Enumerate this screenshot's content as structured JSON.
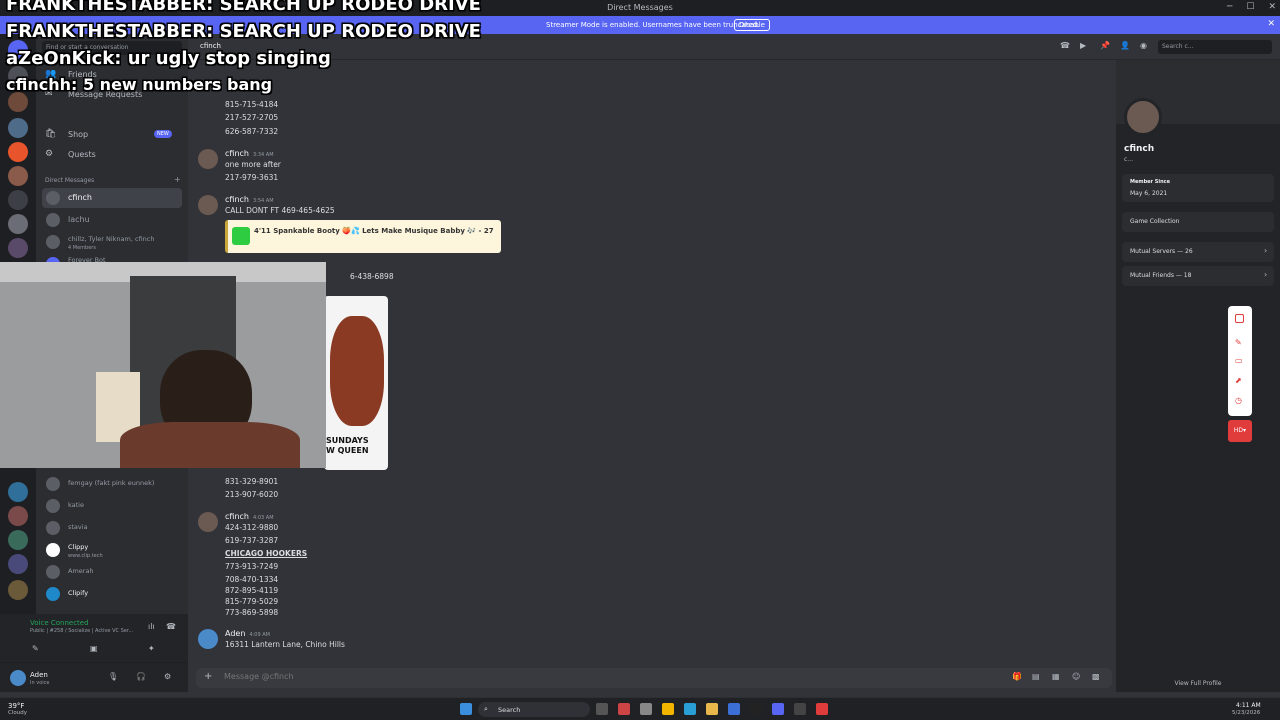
{
  "window": {
    "title": "Direct Messages"
  },
  "streamer_banner": {
    "text": "Streamer Mode is enabled. Usernames have been truncated.",
    "button": "Disable"
  },
  "overlay_chat": [
    {
      "name": "FRANKTHESTABBER",
      "text": ": SEARCH UP RODEO DRIVE"
    },
    {
      "name": "FRANKTHESTABBER",
      "text": ": SEARCH UP RODEO DRIVE"
    },
    {
      "name": "aZeOnKick",
      "text": ": ur ugly stop singing"
    },
    {
      "name": "cfinchh",
      "text": ": 5 new numbers bang"
    }
  ],
  "dm_sidebar": {
    "search_placeholder": "Find or start a conversation",
    "nav": [
      {
        "label": "Friends",
        "icon": "friends-icon"
      },
      {
        "label": "Message Requests",
        "icon": "mail-icon"
      },
      {
        "label": "Shop",
        "icon": "shop-icon",
        "badge": "NEW"
      },
      {
        "label": "Quests",
        "icon": "quests-icon"
      }
    ],
    "section_title": "Direct Messages",
    "dms_top": [
      {
        "name": "cfinch",
        "sub": ""
      },
      {
        "name": "lachu",
        "sub": ""
      },
      {
        "name": "chillz, Tyler Niknam, cfinch",
        "sub": "4 Members"
      },
      {
        "name": "Forever Bot",
        "sub": ""
      }
    ],
    "dms_bottom": [
      {
        "name": "femgay (fakt pink eunnek)",
        "sub": ""
      },
      {
        "name": "katie",
        "sub": ""
      },
      {
        "name": "stavia",
        "sub": ""
      },
      {
        "name": "Clippy",
        "sub": "www.clip.tech"
      },
      {
        "name": "Amerah",
        "sub": ""
      },
      {
        "name": "Clipify",
        "sub": ""
      }
    ]
  },
  "voice": {
    "status": "Voice Connected",
    "channel": "Public | #258 / Socialize | Active VC Ser..."
  },
  "user_panel": {
    "name": "Aden",
    "status": "In voice"
  },
  "topbar": {
    "channel_name": "cfinch",
    "search_placeholder": "Search c..."
  },
  "messages": [
    {
      "author": "",
      "time": "",
      "lines": [
        "815-715-4184",
        "217-527-2705",
        "626-587-7332"
      ]
    },
    {
      "author": "cfinch",
      "time": "3:34 AM",
      "lines": [
        "one more after",
        "217-979-3631"
      ]
    },
    {
      "author": "cfinch",
      "time": "3:54 AM",
      "lines": [
        "CALL DONT FT 469-465-4625"
      ]
    },
    {
      "author": "",
      "time": "",
      "lines": [
        "6-438-6898"
      ]
    },
    {
      "author": "",
      "time": "",
      "lines": [
        "831-329-8901",
        "213-907-6020"
      ]
    },
    {
      "author": "cfinch",
      "time": "4:03 AM",
      "lines": [
        "424-312-9880",
        "619-737-3287",
        "CHICAGO HOOKERS",
        "773-913-7249",
        "708-470-1334",
        "872-895-4119",
        "815-779-5029",
        "773-869-5898"
      ]
    },
    {
      "author": "Aden",
      "time": "4:09 AM",
      "lines": [
        "16311 Lantern Lane, Chino Hills"
      ]
    }
  ],
  "embed": {
    "text": "4'11 Spankable Booty 🍑💦 Lets Make Musique Babby 🎶 - 27"
  },
  "image_caption": [
    "SUNDAYS",
    "W QUEEN"
  ],
  "composer": {
    "placeholder": "Message @cfinch"
  },
  "profile": {
    "name": "cfinch",
    "tag": "c...",
    "member_since_label": "Member Since",
    "member_since": "May 6, 2021",
    "game_collection": "Game Collection",
    "mutual_servers": "Mutual Servers — 26",
    "mutual_friends": "Mutual Friends — 18",
    "view_full_profile": "View Full Profile"
  },
  "taskbar": {
    "weather_temp": "39°F",
    "weather_desc": "Cloudy",
    "search": "Search",
    "time": "4:11 AM",
    "date": "5/23/2026"
  },
  "colors": {
    "bg": "#313338",
    "sidebar": "#2b2d31",
    "servers": "#1e1f22",
    "accent": "#5865f2",
    "danger": "#f23f43",
    "green": "#23a55a"
  }
}
